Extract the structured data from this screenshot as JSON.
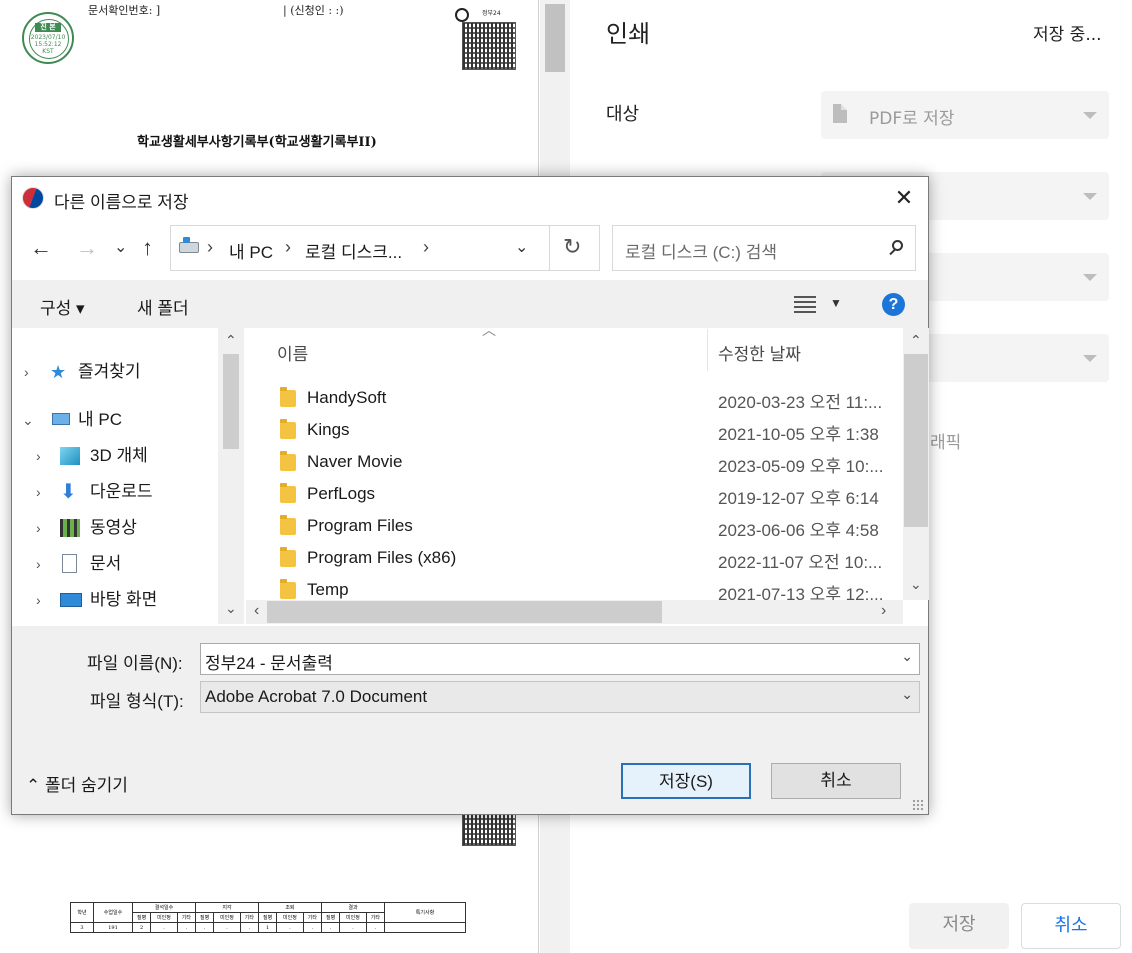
{
  "document": {
    "doc_number_label": "문서확인번호: ]",
    "applicant_label": "| (신청인 :        :)",
    "title": "학교생활세부사항기록부(학교생활기록부II)",
    "stamp": {
      "header": "진 본",
      "date": "2023/07/10",
      "time": "15:52:12",
      "tz": "KST"
    },
    "corner_label": "정부24",
    "table": {
      "head_row1": [
        "학년",
        "수업일수",
        "결석일수",
        "지각",
        "조퇴",
        "결과",
        "특기사항"
      ],
      "sub_head": [
        "질병",
        "미인정",
        "기타",
        "질병",
        "미인정",
        "기타",
        "질병",
        "미인정",
        "기타",
        "질병",
        "미인정",
        "기타"
      ],
      "data_row": [
        "3",
        "191",
        "2",
        ".",
        ".",
        ".",
        ".",
        ".",
        "1",
        ".",
        ".",
        ".",
        ".",
        ".",
        ""
      ]
    }
  },
  "print_panel": {
    "title": "인쇄",
    "status": "저장 중...",
    "destination_label": "대상",
    "destination_value": "PDF로 저장",
    "faded_text": "래픽",
    "save_button": "저장",
    "cancel_button": "취소"
  },
  "dialog": {
    "title": "다른 이름으로 저장",
    "close_glyph": "✕",
    "nav": {
      "back": "←",
      "forward": "→",
      "recent": "⌄",
      "up": "↑"
    },
    "breadcrumb": [
      "내 PC",
      "로컬 디스크..."
    ],
    "breadcrumb_sep": "›",
    "refresh_glyph": "↻",
    "search_placeholder": "로컬 디스크 (C:) 검색",
    "toolbar": {
      "organize": "구성 ▾",
      "new_folder": "새 폴더",
      "help": "?"
    },
    "tree": [
      {
        "label": "즐겨찾기",
        "chevron": "›"
      },
      {
        "label": "내 PC",
        "chevron": "⌄"
      },
      {
        "label": "3D 개체",
        "chevron": "›"
      },
      {
        "label": "다운로드",
        "chevron": "›"
      },
      {
        "label": "동영상",
        "chevron": "›"
      },
      {
        "label": "문서",
        "chevron": "›"
      },
      {
        "label": "바탕 화면",
        "chevron": "›"
      }
    ],
    "columns": {
      "name": "이름",
      "date_modified": "수정한 날짜"
    },
    "files": [
      {
        "name": "HandySoft",
        "date": "2020-03-23 오전 11:..."
      },
      {
        "name": "Kings",
        "date": "2021-10-05 오후 1:38"
      },
      {
        "name": "Naver Movie",
        "date": "2023-05-09 오후 10:..."
      },
      {
        "name": "PerfLogs",
        "date": "2019-12-07 오후 6:14"
      },
      {
        "name": "Program Files",
        "date": "2023-06-06 오후 4:58"
      },
      {
        "name": "Program Files (x86)",
        "date": "2022-11-07 오전 10:..."
      },
      {
        "name": "Temp",
        "date": "2021-07-13 오후 12:..."
      }
    ],
    "filename_label": "파일 이름(N):",
    "filename_value": "정부24 - 문서출력",
    "filetype_label": "파일 형식(T):",
    "filetype_value": "Adobe Acrobat 7.0 Document",
    "hide_folders": "⌃ 폴더 숨기기",
    "save_button": "저장(S)",
    "cancel_button": "취소"
  }
}
